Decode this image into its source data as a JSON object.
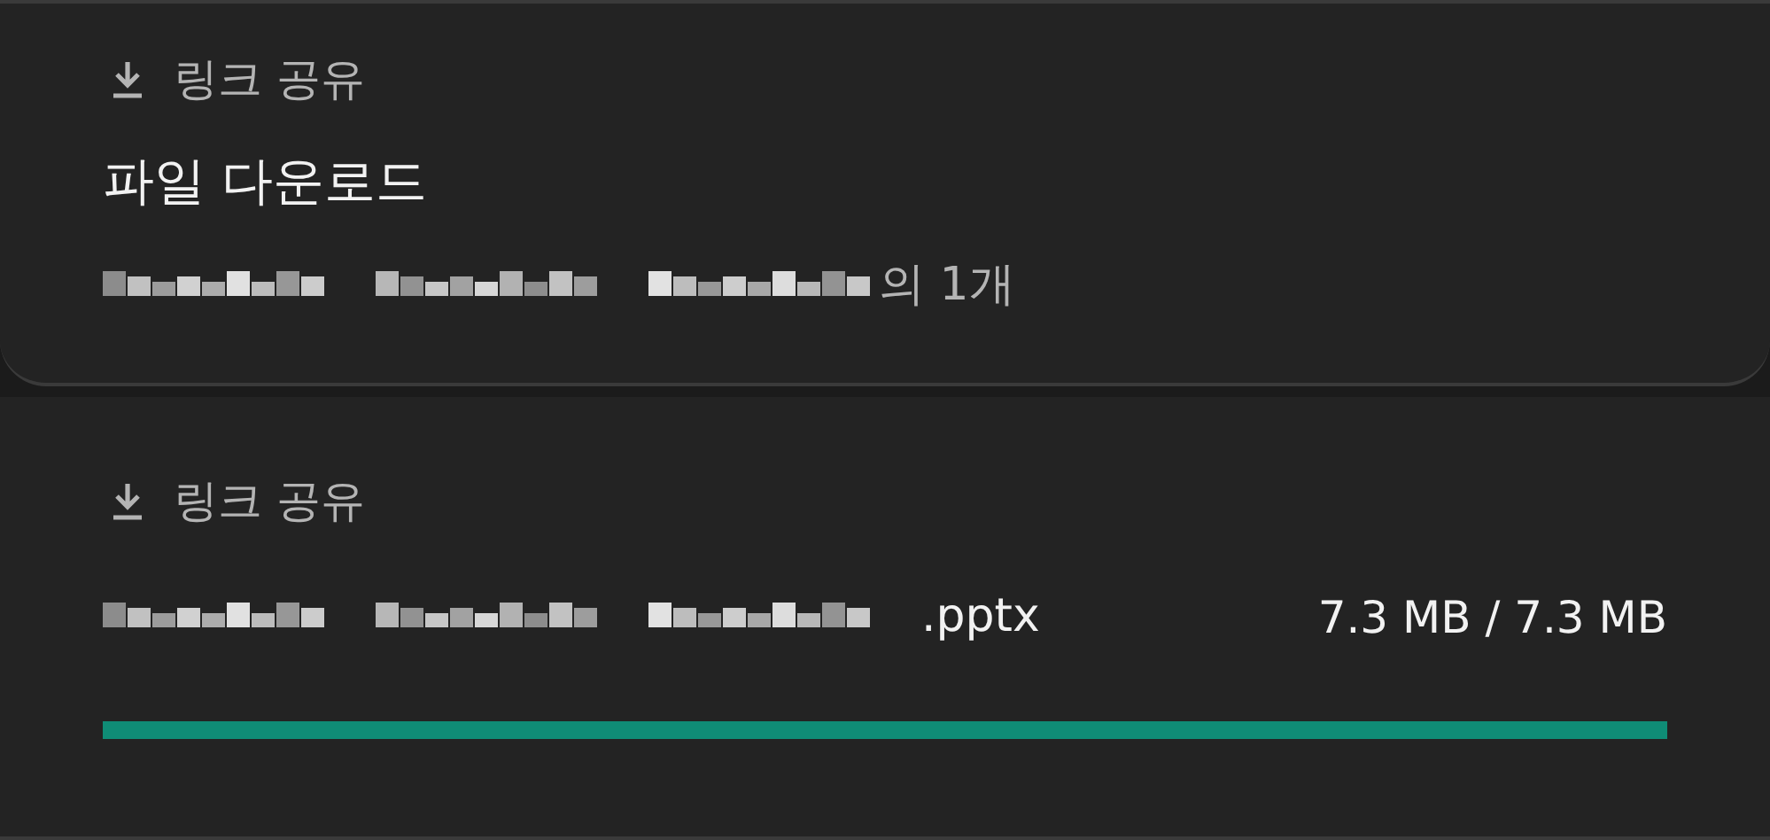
{
  "notifications": [
    {
      "kind": "summary",
      "action": "링크 공유",
      "title": "파일 다운로드",
      "suffix": "의 1개"
    },
    {
      "kind": "progress",
      "action": "링크 공유",
      "extension": ".pptx",
      "size": "7.3 MB / 7.3 MB",
      "progress": {
        "level": 1
      }
    }
  ]
}
